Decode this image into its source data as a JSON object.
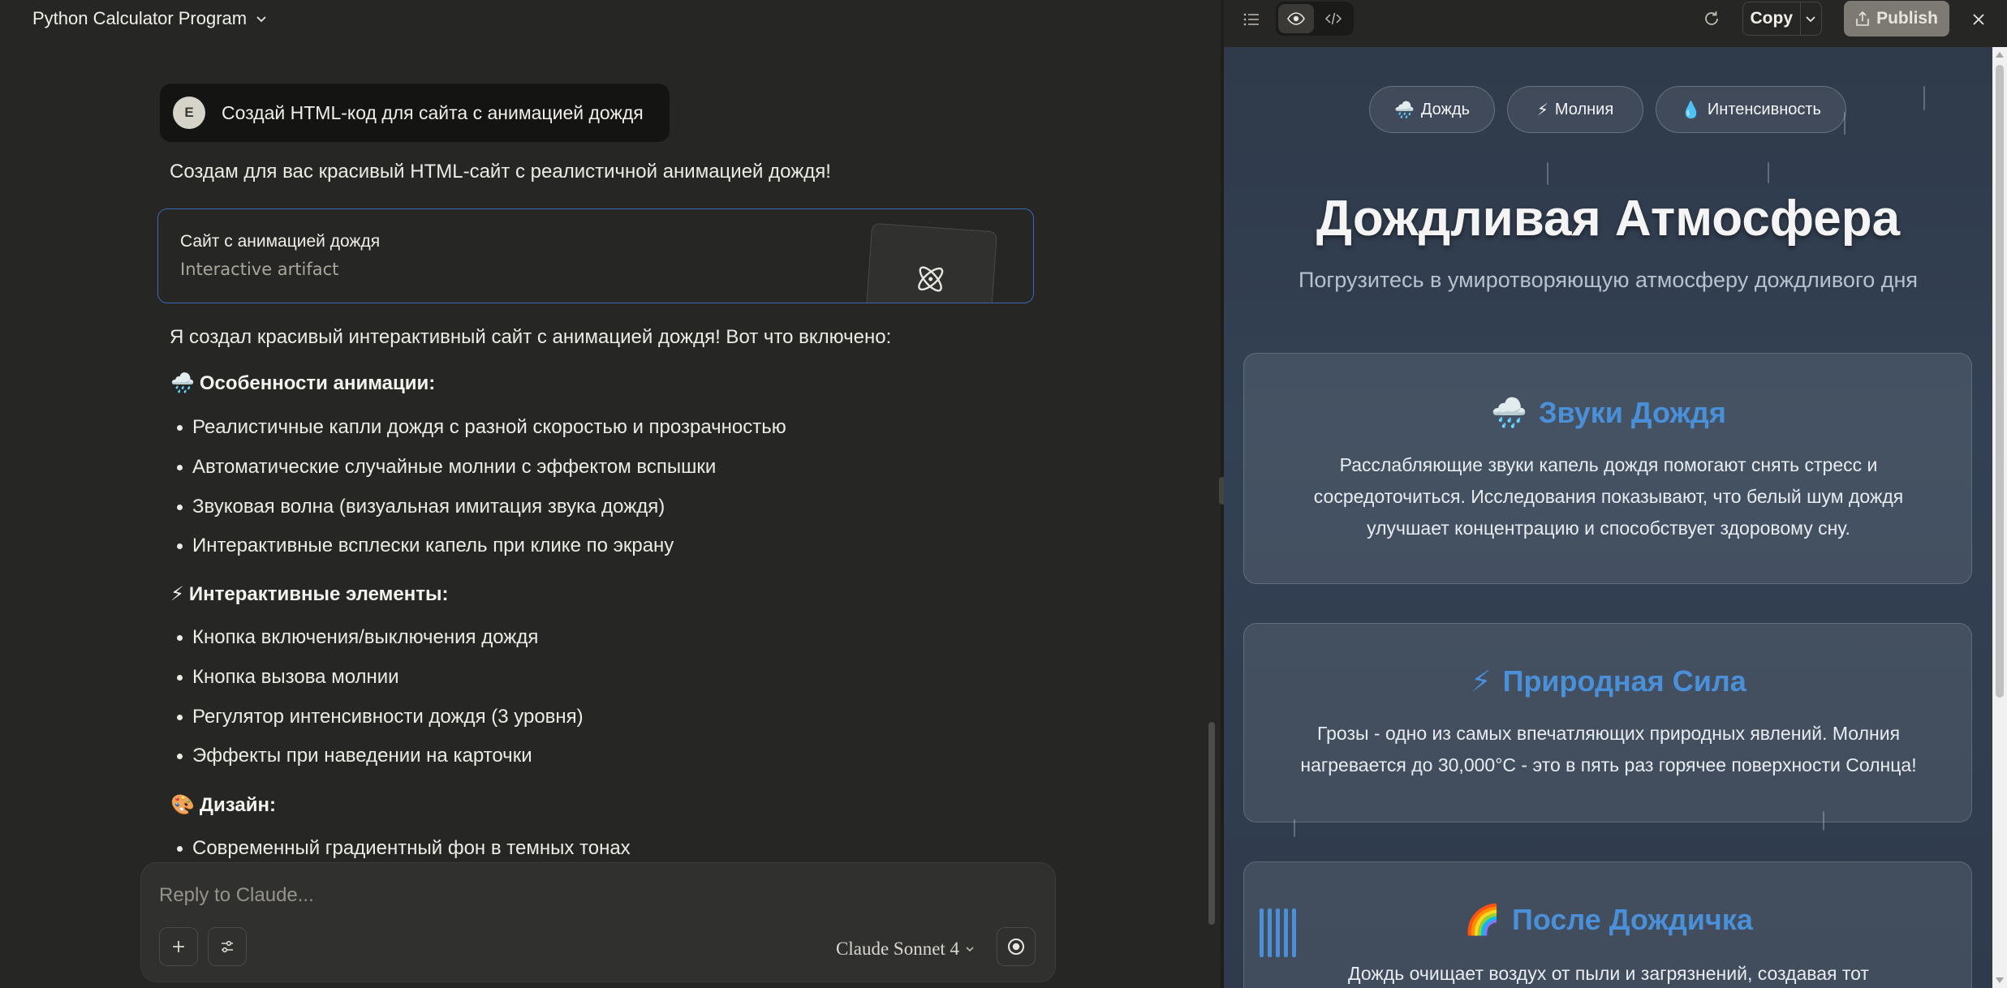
{
  "chat": {
    "title": "Python Calculator Program",
    "user_message": {
      "avatar_initial": "E",
      "text": "Создай HTML-код для сайта с анимацией дождя"
    },
    "assistant_intro": "Создам для вас красивый HTML-сайт с реалистичной анимацией дождя!",
    "artifact": {
      "title": "Сайт с анимацией дождя",
      "subtitle": "Interactive artifact"
    },
    "summary": "Я создал красивый интерактивный сайт с анимацией дождя! Вот что включено:",
    "sections": [
      {
        "emoji": "🌧️",
        "heading": "Особенности анимации:",
        "bullets": [
          "Реалистичные капли дождя с разной скоростью и прозрачностью",
          "Автоматические случайные молнии с эффектом вспышки",
          "Звуковая волна (визуальная имитация звука дождя)",
          "Интерактивные всплески капель при клике по экрану"
        ]
      },
      {
        "emoji": "⚡",
        "heading": "Интерактивные элементы:",
        "bullets": [
          "Кнопка включения/выключения дождя",
          "Кнопка вызова молнии",
          "Регулятор интенсивности дождя (3 уровня)",
          "Эффекты при наведении на карточки"
        ]
      },
      {
        "emoji": "🎨",
        "heading": "Дизайн:",
        "bullets": [
          "Современный градиентный фон в темных тонах"
        ]
      }
    ],
    "composer": {
      "placeholder": "Reply to Claude...",
      "model": "Claude Sonnet 4"
    }
  },
  "artifact_panel": {
    "toolbar": {
      "copy_label": "Copy",
      "publish_label": "Publish"
    },
    "site": {
      "controls": [
        {
          "emoji": "🌧️",
          "label": "Дождь"
        },
        {
          "emoji": "⚡",
          "label": "Молния"
        },
        {
          "emoji": "💧",
          "label": "Интенсивность"
        }
      ],
      "title": "Дождливая Атмосфера",
      "subtitle": "Погрузитесь в умиротворяющую атмосферу дождливого дня",
      "cards": [
        {
          "emoji": "🌧️",
          "title": "Звуки Дождя",
          "text": "Расслабляющие звуки капель дождя помогают снять стресс и сосредоточиться. Исследования показывают, что белый шум дождя улучшает концентрацию и способствует здоровому сну."
        },
        {
          "emoji": "⚡",
          "title": "Природная Сила",
          "text": "Грозы - одно из самых впечатляющих природных явлений. Молния нагревается до 30,000°C - это в пять раз горячее поверхности Солнца!"
        },
        {
          "emoji": "🌈",
          "title": "После Дождичка",
          "text": "Дождь очищает воздух от пыли и загрязнений, создавая тот"
        }
      ]
    }
  },
  "colors": {
    "accent_blue": "#4a90d9",
    "artifact_border": "#3d68b5",
    "publish_bg": "#7c7a72"
  }
}
